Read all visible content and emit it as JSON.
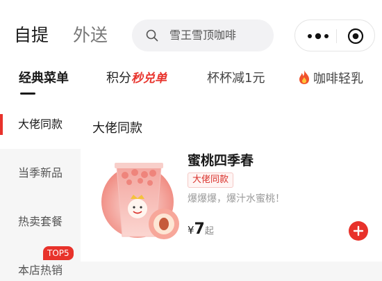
{
  "header": {
    "mode_tabs": [
      {
        "label": "自提",
        "active": true
      },
      {
        "label": "外送",
        "active": false
      }
    ],
    "search": {
      "placeholder": "雪王雪顶咖啡",
      "icon": "search-icon"
    },
    "capsule": {
      "more_icon": "more-dots-icon",
      "close_icon": "close-target-icon"
    }
  },
  "categories": [
    {
      "label": "经典菜单",
      "active": true
    },
    {
      "prefix": "积分",
      "promo": "秒兑单"
    },
    {
      "label": "杯杯减1元"
    },
    {
      "label": "咖啡轻乳",
      "icon": "fire-icon"
    }
  ],
  "sidebar": {
    "items": [
      {
        "label": "大佬同款",
        "active": true
      },
      {
        "label": "当季新品"
      },
      {
        "label": "热卖套餐"
      },
      {
        "label": "本店热销"
      }
    ],
    "badge": "TOP5"
  },
  "section": {
    "title": "大佬同款",
    "product": {
      "name": "蜜桃四季春",
      "tag": "大佬同款",
      "description": "爆爆爆，爆汁水蜜桃！",
      "currency": "¥",
      "price": "7",
      "price_unit": "起"
    }
  },
  "colors": {
    "accent": "#e8322b",
    "sidebar_bg": "#f6f6f6",
    "search_bg": "#f2f2f4"
  }
}
